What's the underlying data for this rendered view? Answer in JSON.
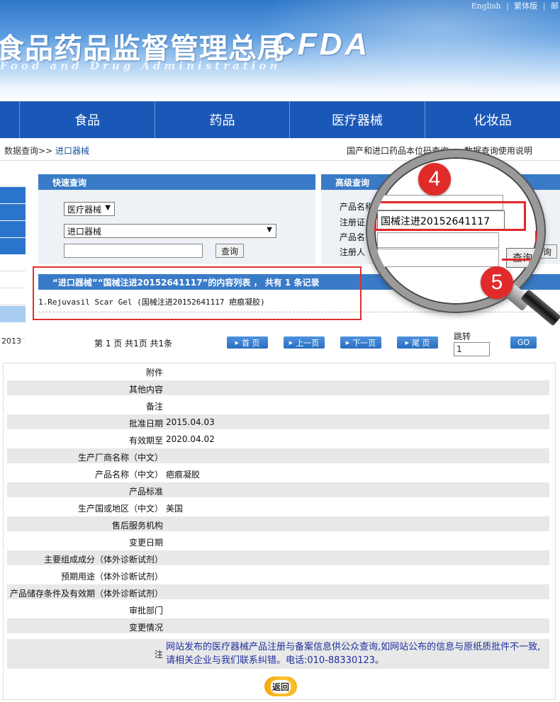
{
  "header": {
    "top_links": [
      "English",
      "繁体版",
      "邮"
    ],
    "agency_cn": "食品药品监督管理总局",
    "agency_logo": "CFDA",
    "agency_en": "Food and Drug Administration"
  },
  "nav": {
    "items": [
      "食品",
      "药品",
      "医疗器械",
      "化妆品"
    ]
  },
  "breadcrumb": {
    "root": "数据查询>>",
    "current": "进口器械"
  },
  "breadcrumb_right": [
    "国产和进口药品本位码查询",
    "数据查询使用说明"
  ],
  "sidebar": {
    "year_text": "2013"
  },
  "quick_search": {
    "title": "快速查询",
    "category": "医疗器械",
    "subcategory": "进口器械",
    "keyword": "",
    "button": "查询"
  },
  "advanced_search": {
    "title": "高级查询",
    "labels": [
      "产品名称",
      "注册证",
      "产品名",
      "注册人"
    ],
    "button_partial": "询"
  },
  "results": {
    "header": "“进口器械”“国械注进20152641117”的内容列表 ， 共有 1 条记录",
    "items": [
      "1.Rejuvasil Scar Gel (国械注进20152641117 疤痕凝胶)"
    ]
  },
  "pager": {
    "summary": "第 1 页 共1页 共1条",
    "buttons": [
      "首 页",
      "上一页",
      "下一页",
      "尾 页"
    ],
    "jump_label": "跳转",
    "jump_value": "1",
    "go": "GO"
  },
  "magnifier": {
    "badge_top": "4",
    "badge_bottom": "5",
    "reg_value": "国械注进20152641117",
    "button": "查询",
    "button_partial": "询"
  },
  "detail": {
    "rows": [
      {
        "label": "附件",
        "value": ""
      },
      {
        "label": "其他内容",
        "value": ""
      },
      {
        "label": "备注",
        "value": ""
      },
      {
        "label": "批准日期",
        "value": "2015.04.03"
      },
      {
        "label": "有效期至",
        "value": "2020.04.02"
      },
      {
        "label": "生产厂商名称（中文）",
        "value": ""
      },
      {
        "label": "产品名称（中文）",
        "value": "疤痕凝胶"
      },
      {
        "label": "产品标准",
        "value": ""
      },
      {
        "label": "生产国或地区（中文）",
        "value": "美国"
      },
      {
        "label": "售后服务机构",
        "value": ""
      },
      {
        "label": "变更日期",
        "value": ""
      },
      {
        "label": "主要组成成分（体外诊断试剂）",
        "value": ""
      },
      {
        "label": "预期用途（体外诊断试剂）",
        "value": ""
      },
      {
        "label": "产品储存条件及有效期（体外诊断试剂）",
        "value": ""
      },
      {
        "label": "审批部门",
        "value": ""
      },
      {
        "label": "变更情况",
        "value": ""
      }
    ],
    "note_label": "注",
    "note_text": "网站发布的医疗器械产品注册与备案信息供公众查询,如网站公布的信息与原纸质批件不一致,请相关企业与我们联系纠错。电话:010-88330123。",
    "back_button": "返回"
  }
}
